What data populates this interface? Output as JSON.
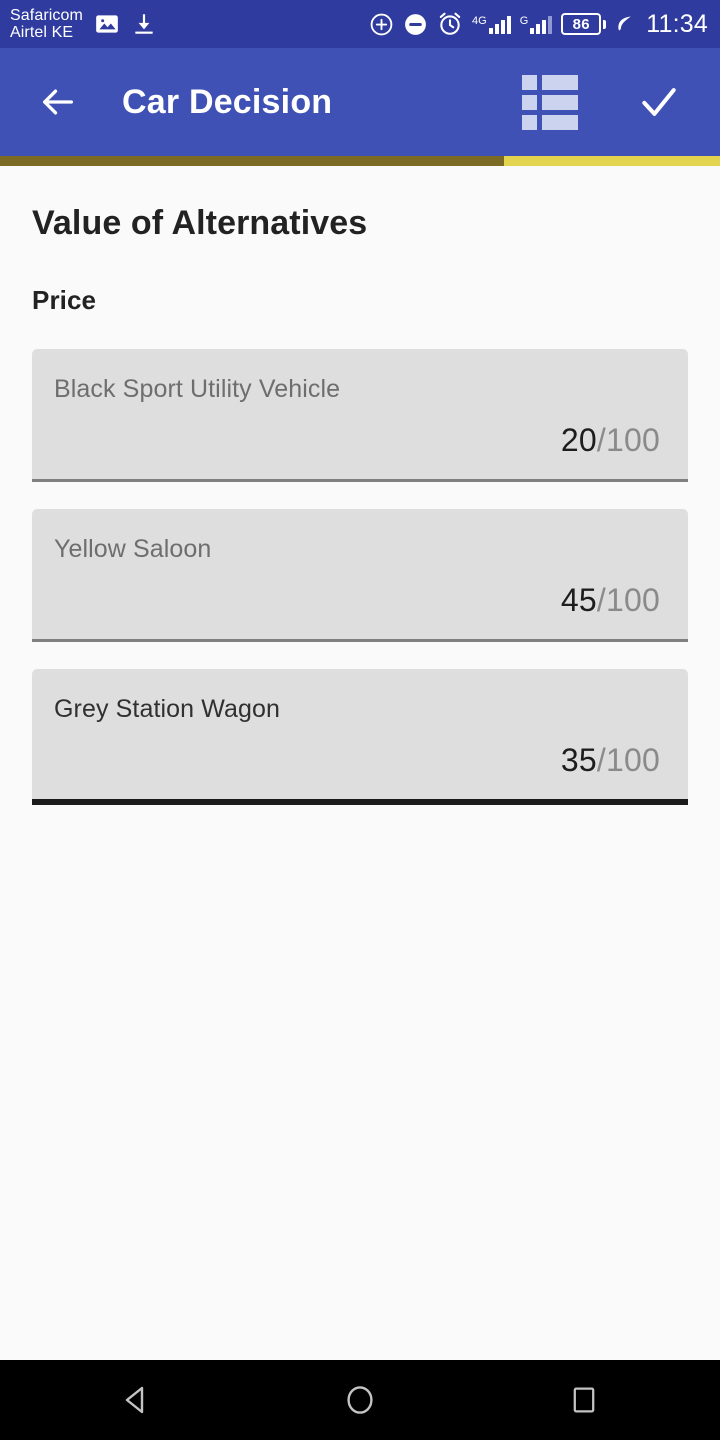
{
  "status_bar": {
    "carrier": "Safaricom\nAirtel KE",
    "icons": [
      "image-icon",
      "download-icon",
      "add-circle-icon",
      "do-not-disturb-icon",
      "alarm-icon"
    ],
    "signal_primary_label": "4G",
    "signal_secondary_label": "G",
    "battery_level": "86",
    "eco_icon": "leaf-icon",
    "time": "11:34",
    "background_color": "#2f3b9e"
  },
  "app_bar": {
    "back_icon": "arrow-left-icon",
    "title": "Car Decision",
    "list_icon": "list-icon",
    "confirm_icon": "check-icon",
    "background_color": "#3f51b5"
  },
  "progress": {
    "percent": 70,
    "fill_color": "#7a6a24",
    "track_color": "#e3d44f"
  },
  "main": {
    "page_title": "Value of Alternatives",
    "section_title": "Price",
    "scale_max": "100",
    "separator": "/",
    "alternatives": [
      {
        "name": "Black Sport Utility Vehicle",
        "value": "20",
        "max": "/100",
        "focused": false
      },
      {
        "name": "Yellow Saloon",
        "value": "45",
        "max": "/100",
        "focused": false
      },
      {
        "name": "Grey Station Wagon",
        "value": "35",
        "max": "/100",
        "focused": true
      }
    ]
  },
  "nav_bar": {
    "back_icon": "triangle-back-icon",
    "home_icon": "circle-home-icon",
    "recents_icon": "square-recents-icon",
    "background_color": "#000000"
  }
}
